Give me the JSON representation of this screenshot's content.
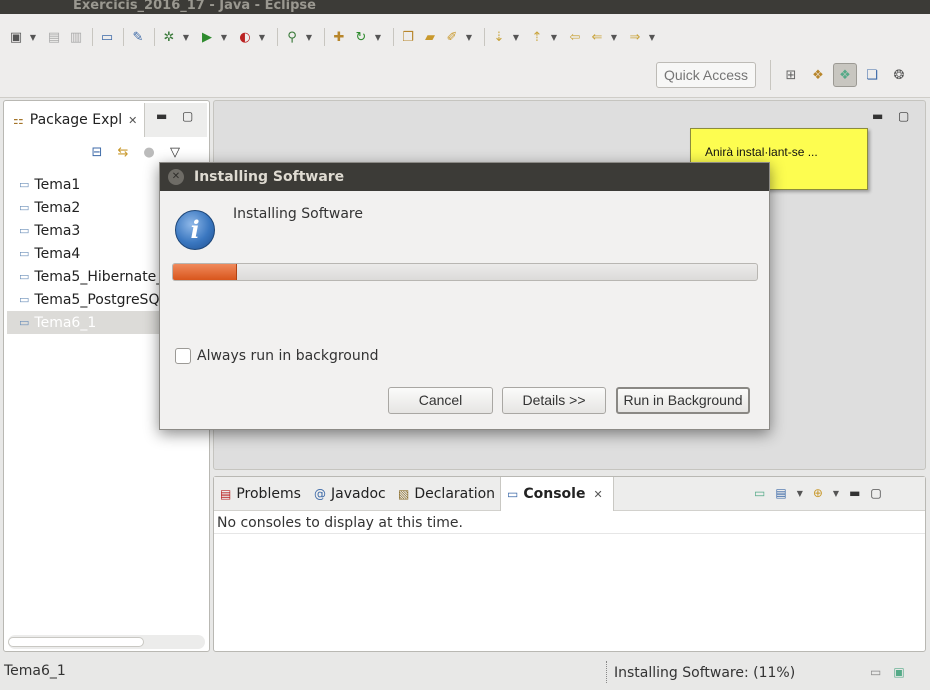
{
  "window": {
    "title": "Exercicis_2016_17 - Java - Eclipse"
  },
  "toolbar": {
    "quick_access_placeholder": "Quick Access",
    "icons": [
      "new-wizard-icon",
      "save-icon",
      "save-all-icon",
      "terminal-icon",
      "pin-icon",
      "debug-icon",
      "run-icon",
      "external-tools-icon",
      "search-icon",
      "new-package-icon",
      "refresh-icon",
      "open-type-icon",
      "open-folder-icon",
      "edit-icon",
      "next-annotation-icon",
      "prev-annotation-icon",
      "last-edit-icon",
      "back-icon",
      "forward-icon"
    ]
  },
  "package_explorer": {
    "tab_label": "Package Expl",
    "items": [
      {
        "label": "Tema1",
        "selected": false
      },
      {
        "label": "Tema2",
        "selected": false
      },
      {
        "label": "Tema3",
        "selected": false
      },
      {
        "label": "Tema4",
        "selected": false
      },
      {
        "label": "Tema5_Hibernate_",
        "selected": false
      },
      {
        "label": "Tema5_PostgreSQ",
        "selected": false
      },
      {
        "label": "Tema6_1",
        "selected": true
      }
    ]
  },
  "tooltip": {
    "text": "Anirà instal·lant-se ..."
  },
  "dialog": {
    "title": "Installing Software",
    "heading": "Installing Software",
    "progress": 0.11,
    "checkbox_label": "Always run in background",
    "checkbox_checked": false,
    "buttons": {
      "cancel": "Cancel",
      "details": "Details >>",
      "run_background": "Run in Background"
    }
  },
  "bottom_panel": {
    "tabs": [
      {
        "label": "Problems",
        "active": false
      },
      {
        "label": "Javadoc",
        "active": false
      },
      {
        "label": "Declaration",
        "active": false
      },
      {
        "label": "Console",
        "active": true
      }
    ],
    "message": "No consoles to display at this time."
  },
  "status": {
    "left": "Tema6_1",
    "right": "Installing Software: (11%)"
  }
}
